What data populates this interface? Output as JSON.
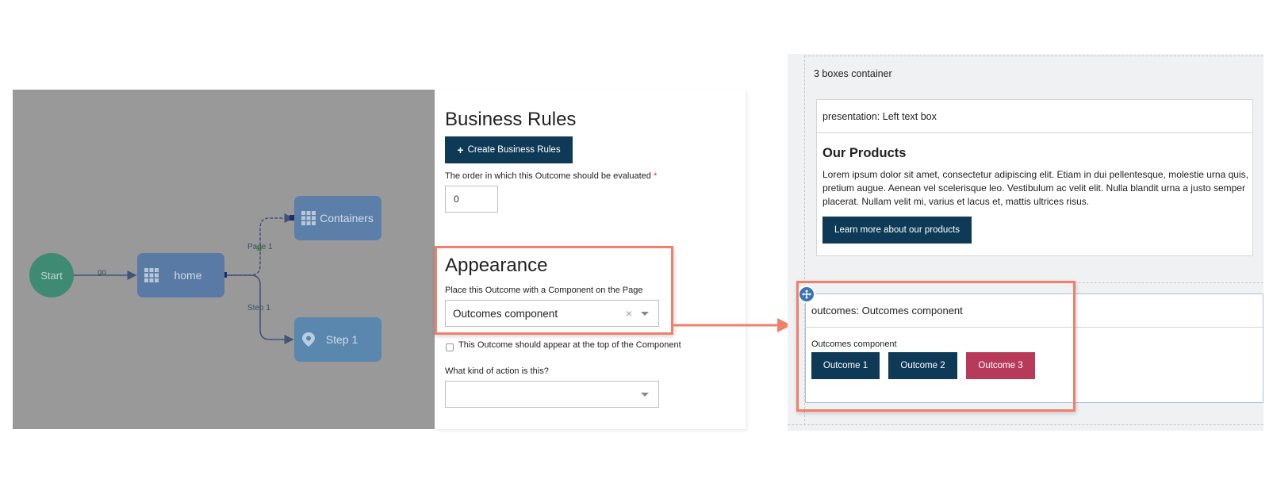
{
  "flow": {
    "start_label": "Start",
    "home_label": "home",
    "containers_label": "Containers",
    "step1_label": "Step 1",
    "edge_go": "go",
    "edge_page1": "Page 1",
    "edge_step1": "Step 1"
  },
  "form": {
    "business_rules_title": "Business Rules",
    "create_rules_button": "Create Business Rules",
    "order_label": "The order in which this Outcome should be evaluated",
    "required_mark": "*",
    "order_value": "0",
    "appearance_title": "Appearance",
    "component_label": "Place this Outcome with a Component on the Page",
    "component_value": "Outcomes component",
    "clear_glyph": "×",
    "top_checkbox_label": "This Outcome should appear at the top of the Component",
    "action_label": "What kind of action is this?",
    "action_value": ""
  },
  "preview": {
    "container_title": "3 boxes container",
    "left_box_header": "presentation: Left text box",
    "products_heading": "Our Products",
    "products_text": "Lorem ipsum dolor sit amet, consectetur adipiscing elit. Etiam in dui pellentesque, molestie urna quis, pretium augue. Aenean vel scelerisque leo. Vestibulum ac velit elit. Nulla blandit urna a justo semper placerat. Nullam velit mi, varius et lacus et, mattis ultrices risus.",
    "learn_more_button": "Learn more about our products",
    "outcomes_box_header": "outcomes: Outcomes component",
    "outcomes_component_label": "Outcomes component",
    "outcome_buttons": [
      "Outcome 1",
      "Outcome 2",
      "Outcome 3"
    ]
  },
  "colors": {
    "highlight": "#f0806b",
    "dark_button": "#0e3a57",
    "outcome3": "#b83a5a",
    "canvas": "#999999"
  }
}
